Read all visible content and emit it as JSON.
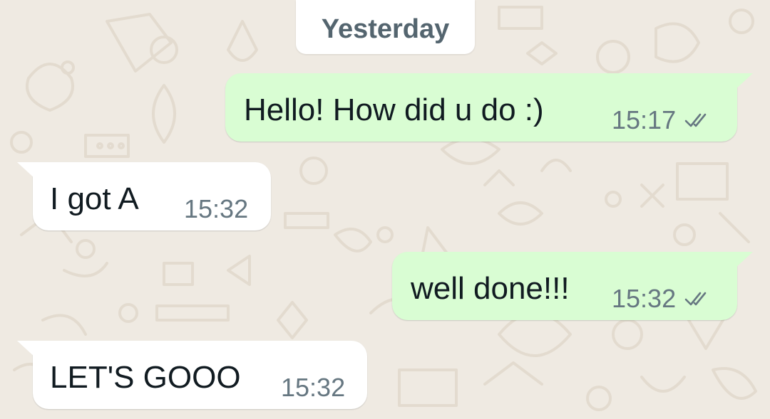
{
  "chat": {
    "date_divider": "Yesterday",
    "messages": [
      {
        "direction": "outgoing",
        "text": "Hello! How did u do :)",
        "time": "15:17",
        "status_icon": "double-check-icon"
      },
      {
        "direction": "incoming",
        "text": "I got A",
        "time": "15:32"
      },
      {
        "direction": "outgoing",
        "text": "well done!!!",
        "time": "15:32",
        "status_icon": "double-check-icon"
      },
      {
        "direction": "incoming",
        "text": "LET'S GOOO",
        "time": "15:32"
      }
    ]
  },
  "colors": {
    "wallpaper": "#efeae2",
    "outgoing_bubble": "#d9fdd3",
    "incoming_bubble": "#ffffff",
    "timestamp": "#667781",
    "date_divider_text": "#54656f",
    "read_ticks": "#667781"
  }
}
